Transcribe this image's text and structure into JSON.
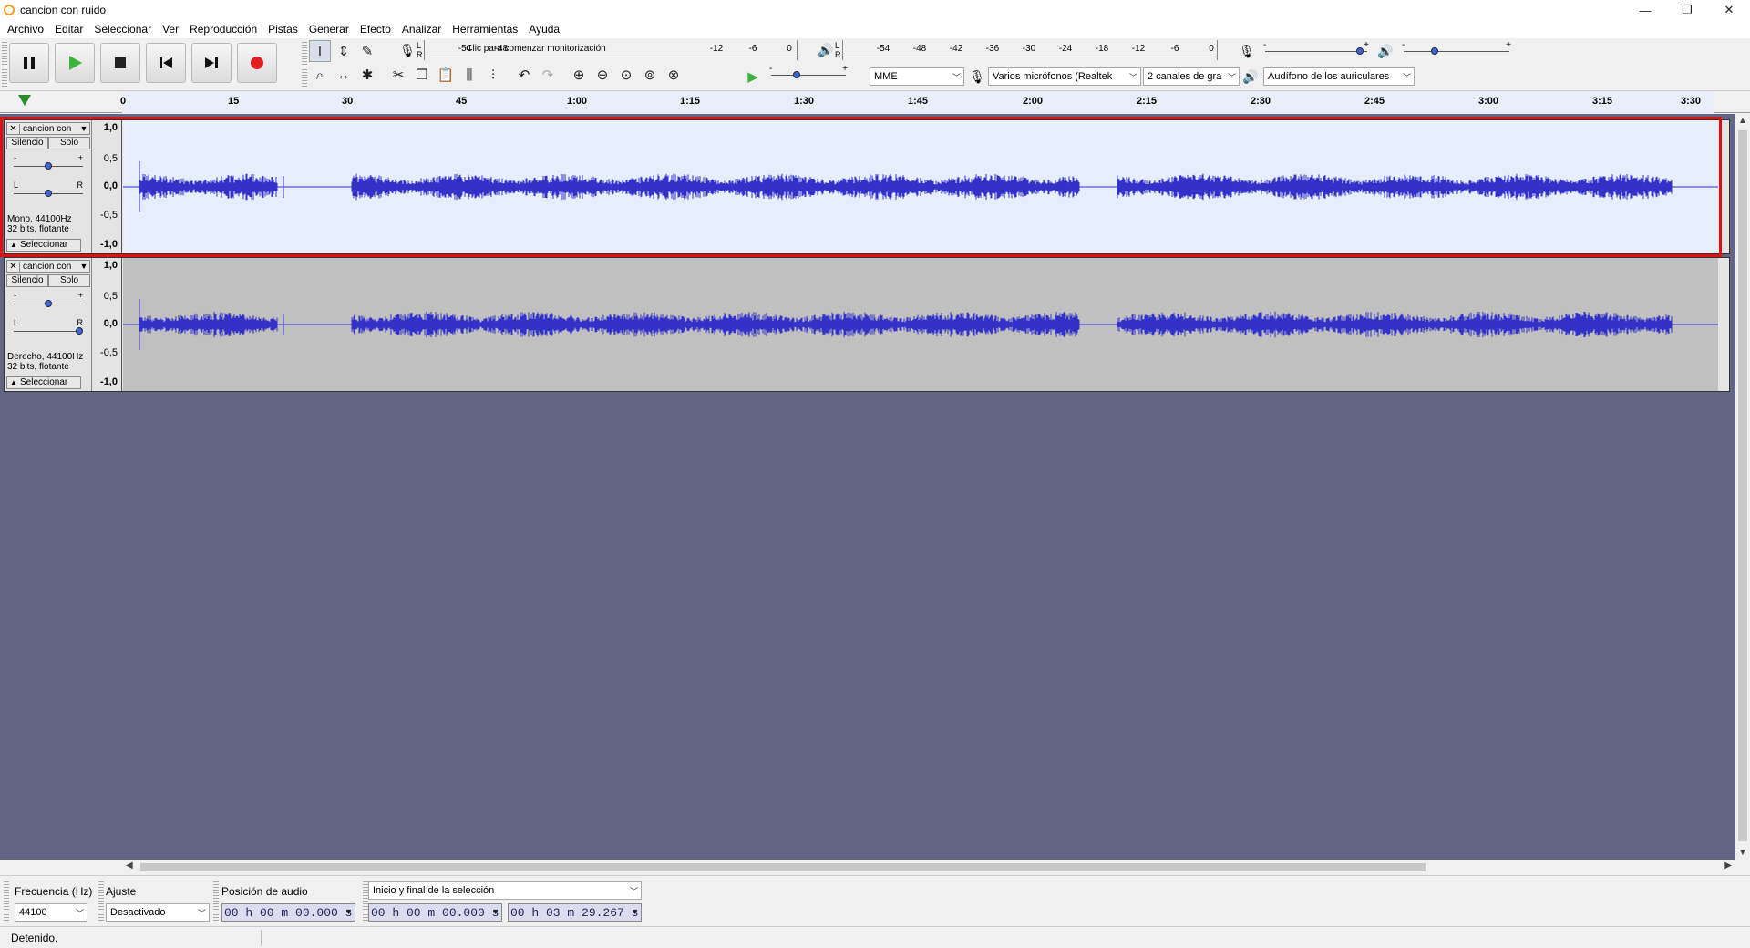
{
  "window": {
    "title": "cancion con ruido",
    "controls": [
      "—",
      "❐",
      "✕"
    ]
  },
  "menu": [
    "Archivo",
    "Editar",
    "Seleccionar",
    "Ver",
    "Reproducción",
    "Pistas",
    "Generar",
    "Efecto",
    "Analizar",
    "Herramientas",
    "Ayuda"
  ],
  "record_meter": {
    "scale": [
      "-54",
      "-48",
      "-12",
      "-6",
      "0"
    ],
    "hint": "Clic para comenzar monitorización",
    "L": "L",
    "R": "R"
  },
  "play_meter": {
    "scale": [
      "-54",
      "-48",
      "-42",
      "-36",
      "-30",
      "-24",
      "-18",
      "-12",
      "-6",
      "0"
    ],
    "L": "L",
    "R": "R"
  },
  "mixer": {
    "minus": "-",
    "plus": "+"
  },
  "devices": {
    "host": "MME",
    "recording_device": "Varios micrófonos (Realtek",
    "channels": "2 canales de gra",
    "playback_device": "Audífono de los auriculares"
  },
  "ruler": {
    "ticks": [
      "0",
      "15",
      "30",
      "45",
      "1:00",
      "1:15",
      "1:30",
      "1:45",
      "2:00",
      "2:15",
      "2:30",
      "2:45",
      "3:00",
      "3:15",
      "3:30"
    ]
  },
  "tracks": [
    {
      "name": "cancion con",
      "mute": "Silencio",
      "solo": "Solo",
      "gain_minus": "-",
      "gain_plus": "+",
      "pan_l": "L",
      "pan_r": "R",
      "info1": "Mono, 44100Hz",
      "info2": "32 bits, flotante",
      "select": "Seleccionar",
      "scale": [
        "1,0",
        "0,5",
        "0,0",
        "-0,5",
        "-1,0"
      ],
      "selected": true
    },
    {
      "name": "cancion con",
      "mute": "Silencio",
      "solo": "Solo",
      "gain_minus": "-",
      "gain_plus": "+",
      "pan_l": "L",
      "pan_r": "R",
      "info1": "Derecho, 44100Hz",
      "info2": "32 bits, flotante",
      "select": "Seleccionar",
      "scale": [
        "1,0",
        "0,5",
        "0,0",
        "-0,5",
        "-1,0"
      ],
      "selected": false
    }
  ],
  "selection_toolbar": {
    "rate_label": "Frecuencia (Hz)",
    "rate_value": "44100",
    "snap_label": "Ajuste",
    "snap_value": "Desactivado",
    "position_label": "Posición de audio",
    "position_value": "00 h 00 m 00.000 s",
    "selection_mode": "Inicio y final de la selección",
    "selection_start": "00 h 00 m 00.000 s",
    "selection_end": "00 h 03 m 29.267 s"
  },
  "status": "Detenido.",
  "colors": {
    "waveform": "#3232c8",
    "track_bg_selected": "#e6eefc",
    "track_bg": "#c0c0c0",
    "project_bg": "#636584",
    "highlight": "#e01010"
  }
}
